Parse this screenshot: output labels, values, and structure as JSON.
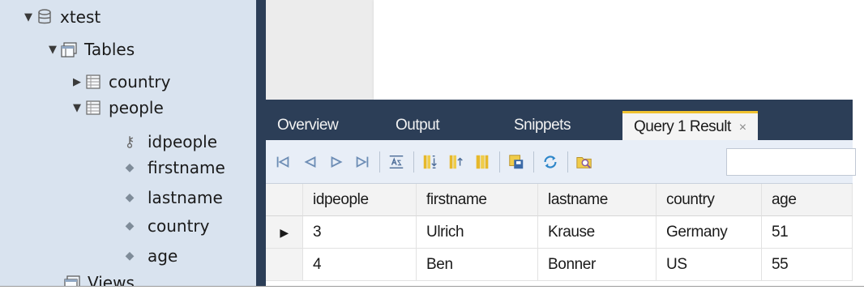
{
  "navigator": {
    "schema": "xtest",
    "tables_label": "Tables",
    "tables": [
      {
        "name": "country",
        "expanded": false
      },
      {
        "name": "people",
        "expanded": true
      }
    ],
    "columns": [
      "idpeople",
      "firstname",
      "lastname",
      "country",
      "age"
    ],
    "views_label": "Views"
  },
  "result_panel": {
    "tabs": [
      {
        "label": "Overview",
        "active": false
      },
      {
        "label": "Output",
        "active": false
      },
      {
        "label": "Snippets",
        "active": false
      },
      {
        "label": "Query 1 Result",
        "active": true,
        "close": "×"
      }
    ],
    "grid": {
      "columns": [
        "idpeople",
        "firstname",
        "lastname",
        "country",
        "age"
      ],
      "rows": [
        {
          "idpeople": "3",
          "firstname": "Ulrich",
          "lastname": "Krause",
          "country": "Germany",
          "age": "51",
          "current": true
        },
        {
          "idpeople": "4",
          "firstname": "Ben",
          "lastname": "Bonner",
          "country": "US",
          "age": "55",
          "current": false
        }
      ],
      "current_row_marker": "▶"
    }
  },
  "colors": {
    "navigator_bg": "#d9e3ef",
    "dark_panel": "#2c3e57",
    "active_tab_accent": "#f0c230"
  }
}
